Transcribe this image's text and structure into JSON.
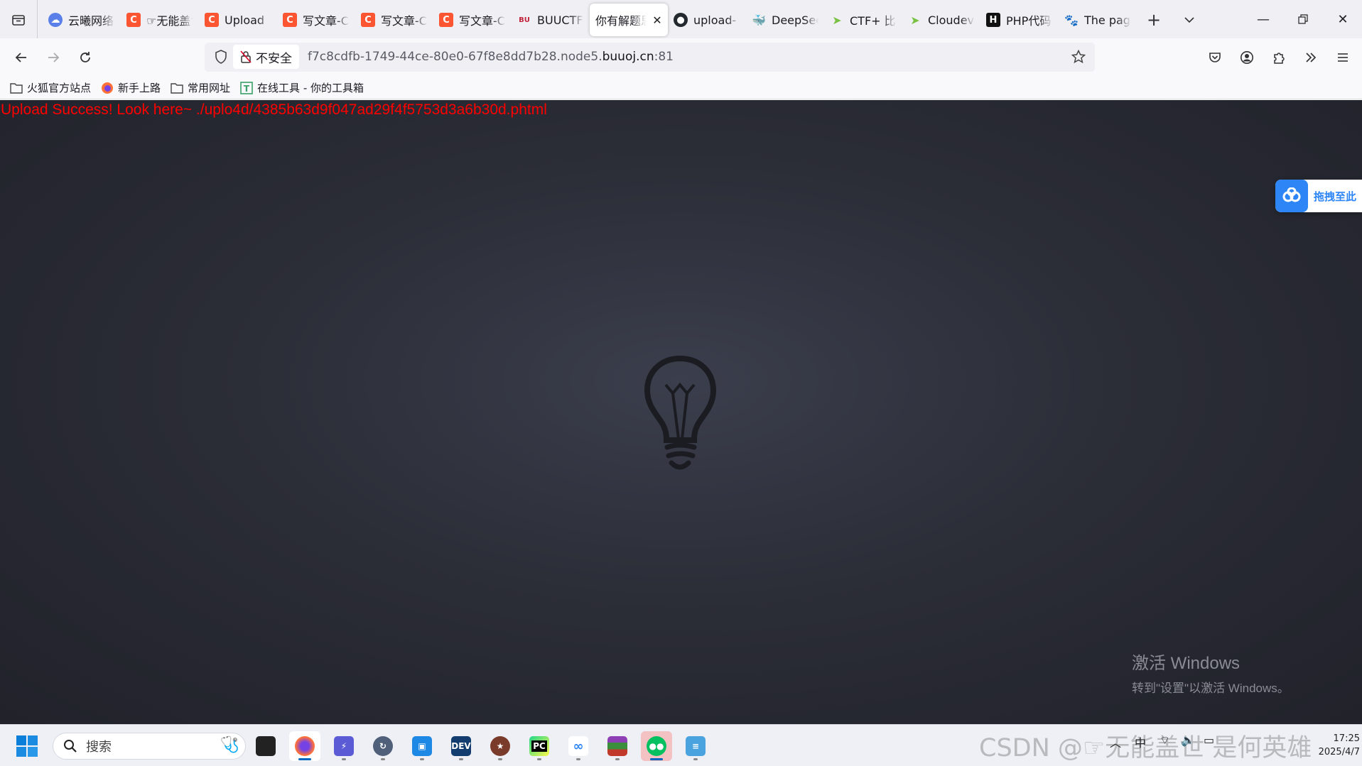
{
  "browser": {
    "tabs": [
      {
        "label": "云曦网络",
        "icon": "cloud-icon",
        "active": false
      },
      {
        "label": "☞无能盖世",
        "icon": "csdn-icon",
        "active": false
      },
      {
        "label": "Upload",
        "icon": "csdn-icon",
        "active": false
      },
      {
        "label": "写文章-C",
        "icon": "csdn-icon",
        "active": false
      },
      {
        "label": "写文章-C",
        "icon": "csdn-icon",
        "active": false
      },
      {
        "label": "写文章-C",
        "icon": "csdn-icon",
        "active": false
      },
      {
        "label": "BUUCTF",
        "icon": "buuctf-icon",
        "active": false
      },
      {
        "label": "你有解题思",
        "icon": "",
        "active": true
      },
      {
        "label": "upload-",
        "icon": "github-icon",
        "active": false
      },
      {
        "label": "DeepSeek",
        "icon": "deepseek-icon",
        "active": false
      },
      {
        "label": "CTF+ 比",
        "icon": "ctf-icon",
        "active": false
      },
      {
        "label": "Cloudev",
        "icon": "ctf-icon",
        "active": false
      },
      {
        "label": "PHP代码",
        "icon": "h-icon",
        "active": false
      },
      {
        "label": "The pag",
        "icon": "baidu-icon",
        "active": false
      }
    ],
    "url": {
      "security_label": "不安全",
      "prefix": "f7c8cdfb-1749-44ce-80e0-67f8e8dd7b28.node5.",
      "host": "buuoj.cn",
      "suffix": ":81"
    },
    "bookmarks": [
      {
        "label": "火狐官方站点",
        "icon": "folder-icon"
      },
      {
        "label": "新手上路",
        "icon": "firefox-icon"
      },
      {
        "label": "常用网址",
        "icon": "folder-icon"
      },
      {
        "label": "在线工具 - 你的工具箱",
        "icon": "tool-icon"
      }
    ]
  },
  "page": {
    "message": "Upload Success! Look here~ ./uplo4d/4385b63d9f047ad29f4f5753d3a6b30d.phtml",
    "drag_widget_label": "拖拽至此",
    "activation_title": "激活 Windows",
    "activation_subtitle": "转到\"设置\"以激活 Windows。"
  },
  "taskbar": {
    "search_placeholder": "搜索",
    "apps": [
      "windows-explorer",
      "firefox",
      "power-toys",
      "update-tool",
      "box-app",
      "dev-cpp",
      "game-app",
      "pycharm",
      "baidu-netdisk",
      "winrar",
      "wechat",
      "notepad"
    ],
    "time": "17:25",
    "date": "2025/4/7",
    "watermark": "CSDN @☞无能盖世 是何英雄"
  },
  "colors": {
    "message": "#ff0000",
    "accent": "#0067c0",
    "page_bg": "#2b2d37"
  }
}
